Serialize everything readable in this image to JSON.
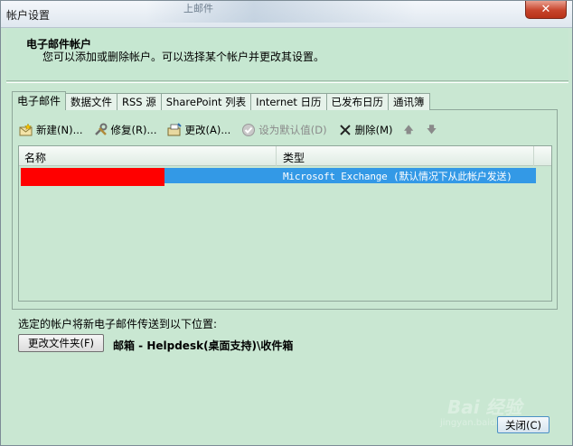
{
  "window": {
    "title": "帐户设置",
    "background_title": "上邮件",
    "close_glyph": "✕"
  },
  "header": {
    "title": "电子邮件帐户",
    "description": "您可以添加或删除帐户。可以选择某个帐户并更改其设置。"
  },
  "tabs": [
    {
      "label": "电子邮件",
      "active": true
    },
    {
      "label": "数据文件"
    },
    {
      "label": "RSS 源"
    },
    {
      "label": "SharePoint 列表"
    },
    {
      "label": "Internet 日历"
    },
    {
      "label": "已发布日历"
    },
    {
      "label": "通讯簿"
    }
  ],
  "toolbar": {
    "new_label": "新建(N)...",
    "repair_label": "修复(R)...",
    "change_label": "更改(A)...",
    "default_label": "设为默认值(D)",
    "delete_label": "删除(M)",
    "up_glyph": "🡅",
    "down_glyph": "🡇"
  },
  "list": {
    "col_name": "名称",
    "col_type": "类型",
    "rows": [
      {
        "name": "",
        "type": "Microsoft Exchange (默认情况下从此帐户发送)"
      }
    ]
  },
  "delivery": {
    "label": "选定的帐户将新电子邮件传送到以下位置:",
    "change_folder_label": "更改文件夹(F)",
    "mailbox_path": "邮箱 - Helpdesk(桌面支持)\\收件箱"
  },
  "footer": {
    "close_label": "关闭(C)"
  },
  "watermark": {
    "text": "Bai 经验",
    "sub": "jingyan.baidu.com"
  }
}
